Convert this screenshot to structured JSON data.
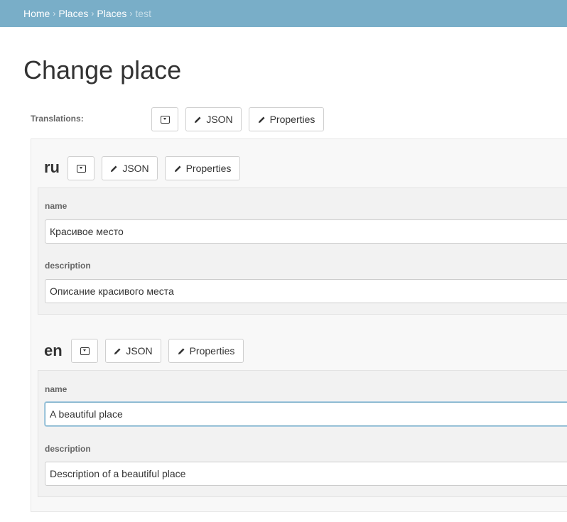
{
  "breadcrumbs": {
    "items": [
      "Home",
      "Places",
      "Places"
    ],
    "separator": "›",
    "current": "test"
  },
  "page": {
    "title": "Change place"
  },
  "translations": {
    "label": "Translations:",
    "json_label": "JSON",
    "properties_label": "Properties"
  },
  "languages": [
    {
      "code": "ru",
      "json_label": "JSON",
      "properties_label": "Properties",
      "fields": [
        {
          "label": "name",
          "value": "Красивое место"
        },
        {
          "label": "description",
          "value": "Описание красивого места"
        }
      ]
    },
    {
      "code": "en",
      "json_label": "JSON",
      "properties_label": "Properties",
      "fields": [
        {
          "label": "name",
          "value": "A beautiful place"
        },
        {
          "label": "description",
          "value": "Description of a beautiful place"
        }
      ]
    }
  ],
  "icons": {
    "edit": "pencil-icon",
    "toggle": "toggle-dropdown-icon"
  },
  "colors": {
    "breadcrumb_bg": "#79aec8",
    "focus_border": "#79aec8"
  }
}
